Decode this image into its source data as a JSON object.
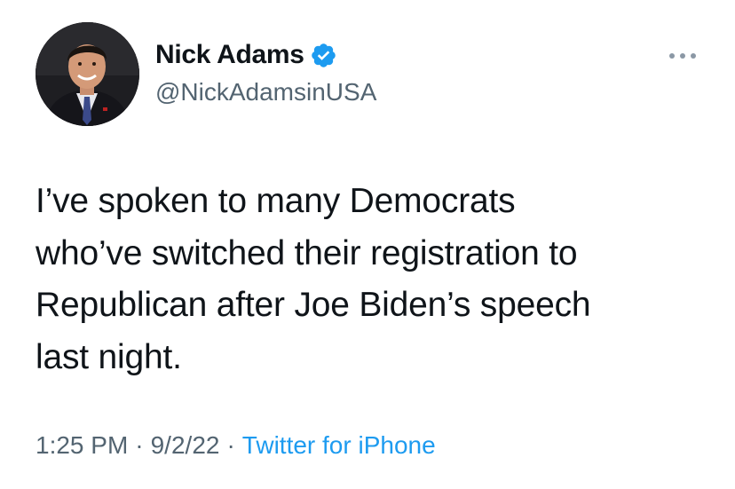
{
  "author": {
    "display_name": "Nick Adams",
    "handle": "@NickAdamsinUSA",
    "verified": true,
    "avatar_icon": "profile-photo"
  },
  "tweet": {
    "text_lines": [
      "I’ve spoken to many Democrats",
      "who’ve switched their registration to",
      "Republican after Joe Biden’s speech",
      "last night."
    ]
  },
  "meta": {
    "time": "1:25 PM",
    "separator": "·",
    "date": "9/2/22",
    "source": "Twitter for iPhone"
  },
  "icons": {
    "verified": "verified-badge-icon",
    "more": "more-options-icon"
  },
  "colors": {
    "text": "#0f1419",
    "secondary": "#536471",
    "accent": "#1d9bf0"
  }
}
